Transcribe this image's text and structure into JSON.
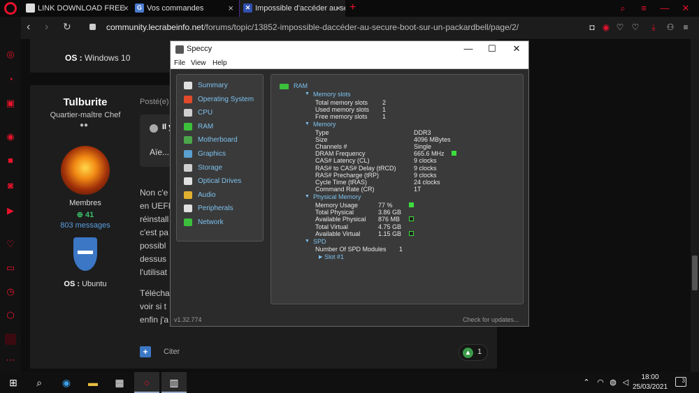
{
  "browser": {
    "tabs": [
      {
        "label": "LINK DOWNLOAD FREE",
        "active": false
      },
      {
        "label": "Vos commandes",
        "active": false
      },
      {
        "label": "Impossible d'accéder au se",
        "active": true
      }
    ],
    "url_host": "community.lecrabeinfo.net",
    "url_path": "/forums/topic/13852-impossible-daccéder-au-secure-boot-sur-un-packardbell/page/2/"
  },
  "forum": {
    "prev_post_os_label": "OS :",
    "prev_post_os_value": "Windows 10",
    "author": {
      "name": "Tulburite",
      "rank": "Quartier-maître Chef",
      "group": "Membres",
      "reputation": "41",
      "messages": "803 messages",
      "os_label": "OS :",
      "os_value": "Ubuntu"
    },
    "posted_label": "Posté(e)",
    "quote_title": "Il y",
    "quote_body": "Aïe...",
    "body_lines": [
      "Non c'e",
      "en UEFI",
      "réinstall",
      "c'est pa",
      "possibl",
      "dessus",
      "l'utilisat",
      "Télécha",
      "voir si t",
      "enfin j'a"
    ],
    "cite_label": "Citer",
    "vote_count": "1"
  },
  "speccy": {
    "title": "Speccy",
    "menu": [
      "File",
      "View",
      "Help"
    ],
    "nav": [
      {
        "label": "Summary",
        "icon": "summary-icon",
        "color": "#e0e0e0"
      },
      {
        "label": "Operating System",
        "icon": "windows-icon",
        "color": "#e04a2a"
      },
      {
        "label": "CPU",
        "icon": "cpu-icon",
        "color": "#cfcfcf"
      },
      {
        "label": "RAM",
        "icon": "ram-icon",
        "color": "#3cc03c"
      },
      {
        "label": "Motherboard",
        "icon": "motherboard-icon",
        "color": "#4aa64a"
      },
      {
        "label": "Graphics",
        "icon": "graphics-icon",
        "color": "#5aa0d0"
      },
      {
        "label": "Storage",
        "icon": "storage-icon",
        "color": "#cfcfcf"
      },
      {
        "label": "Optical Drives",
        "icon": "optical-drive-icon",
        "color": "#e0e0e0"
      },
      {
        "label": "Audio",
        "icon": "audio-icon",
        "color": "#e0b030"
      },
      {
        "label": "Peripherals",
        "icon": "peripherals-icon",
        "color": "#e0e0e0"
      },
      {
        "label": "Network",
        "icon": "network-icon",
        "color": "#3cc03c"
      }
    ],
    "section_title": "RAM",
    "memory_slots": {
      "heading": "Memory slots",
      "rows": [
        {
          "label": "Total memory slots",
          "value": "2"
        },
        {
          "label": "Used memory slots",
          "value": "1"
        },
        {
          "label": "Free memory slots",
          "value": "1"
        }
      ]
    },
    "memory": {
      "heading": "Memory",
      "rows": [
        {
          "label": "Type",
          "value": "DDR3"
        },
        {
          "label": "Size",
          "value": "4096 MBytes"
        },
        {
          "label": "Channels #",
          "value": "Single"
        },
        {
          "label": "DRAM Frequency",
          "value": "665.6 MHz"
        },
        {
          "label": "CAS# Latency (CL)",
          "value": "9 clocks"
        },
        {
          "label": "RAS# to CAS# Delay (tRCD)",
          "value": "9 clocks"
        },
        {
          "label": "RAS# Precharge (tRP)",
          "value": "9 clocks"
        },
        {
          "label": "Cycle Time (tRAS)",
          "value": "24 clocks"
        },
        {
          "label": "Command Rate (CR)",
          "value": "1T"
        }
      ]
    },
    "physical_memory": {
      "heading": "Physical Memory",
      "rows": [
        {
          "label": "Memory Usage",
          "value": "77 %"
        },
        {
          "label": "Total Physical",
          "value": "3.86 GB"
        },
        {
          "label": "Available Physical",
          "value": "876 MB"
        },
        {
          "label": "Total Virtual",
          "value": "4.75 GB"
        },
        {
          "label": "Available Virtual",
          "value": "1.15 GB"
        }
      ]
    },
    "spd": {
      "heading": "SPD",
      "modules_label": "Number Of SPD Modules",
      "modules_value": "1",
      "slot_label": "Slot #1"
    },
    "version": "v1.32.774",
    "check_updates": "Check for updates..."
  },
  "taskbar": {
    "time": "18:00",
    "date": "25/03/2021",
    "notifications": "3"
  }
}
